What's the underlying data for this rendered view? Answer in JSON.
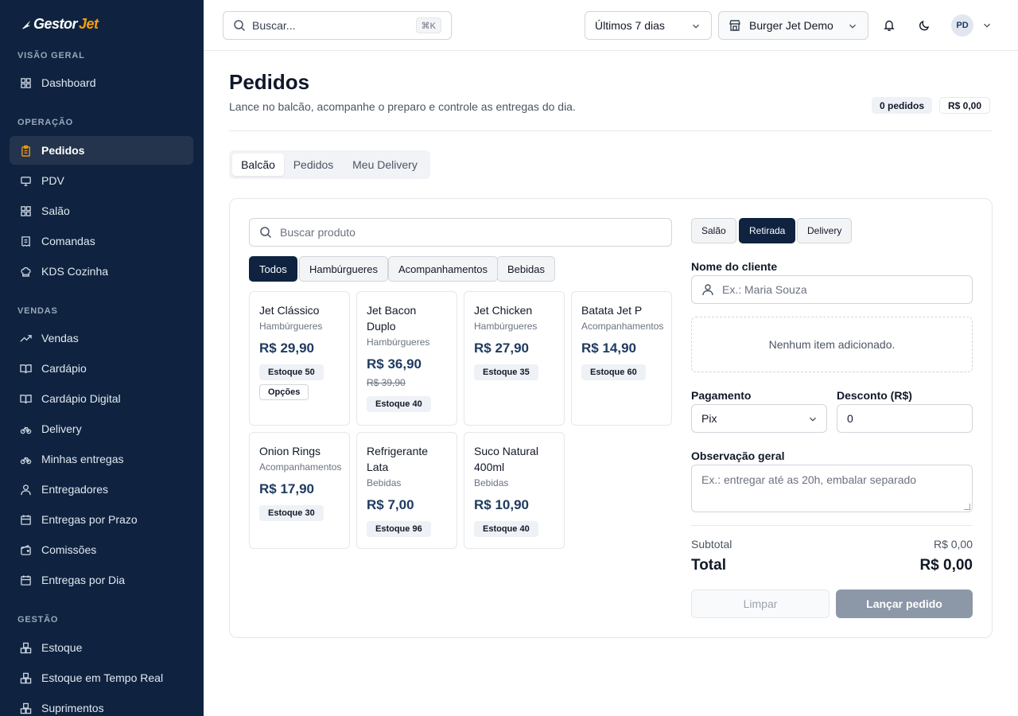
{
  "brand": {
    "logo_main": "Gestor",
    "logo_accent": "Jet"
  },
  "sidebar": {
    "sections": [
      {
        "label": "VISÃO GERAL",
        "items": [
          {
            "label": "Dashboard",
            "icon": "grid-icon"
          }
        ]
      },
      {
        "label": "OPERAÇÃO",
        "items": [
          {
            "label": "Pedidos",
            "icon": "clipboard-icon",
            "active": true
          },
          {
            "label": "PDV",
            "icon": "monitor-icon"
          },
          {
            "label": "Salão",
            "icon": "grid-icon"
          },
          {
            "label": "Comandas",
            "icon": "receipt-icon"
          },
          {
            "label": "KDS Cozinha",
            "icon": "chef-hat-icon"
          }
        ]
      },
      {
        "label": "VENDAS",
        "items": [
          {
            "label": "Vendas",
            "icon": "trending-up-icon"
          },
          {
            "label": "Cardápio",
            "icon": "book-open-icon"
          },
          {
            "label": "Cardápio Digital",
            "icon": "book-open-icon"
          },
          {
            "label": "Delivery",
            "icon": "bike-icon"
          },
          {
            "label": "Minhas entregas",
            "icon": "bike-icon"
          },
          {
            "label": "Entregadores",
            "icon": "user-icon"
          },
          {
            "label": "Entregas por Prazo",
            "icon": "calendar-icon"
          },
          {
            "label": "Comissões",
            "icon": "wallet-icon"
          },
          {
            "label": "Entregas por Dia",
            "icon": "calendar-icon"
          }
        ]
      },
      {
        "label": "GESTÃO",
        "items": [
          {
            "label": "Estoque",
            "icon": "boxes-icon"
          },
          {
            "label": "Estoque em Tempo Real",
            "icon": "boxes-icon"
          },
          {
            "label": "Suprimentos",
            "icon": "boxes-icon"
          }
        ]
      }
    ]
  },
  "topbar": {
    "search_placeholder": "Buscar...",
    "search_shortcut": "⌘K",
    "period": "Últimos 7 dias",
    "store": "Burger Jet Demo",
    "avatar_initials": "PD"
  },
  "page": {
    "title": "Pedidos",
    "subtitle": "Lance no balcão, acompanhe o preparo e controle as entregas do dia.",
    "badge_count": "0 pedidos",
    "badge_total": "R$ 0,00"
  },
  "tabs": [
    {
      "label": "Balcão",
      "active": true
    },
    {
      "label": "Pedidos"
    },
    {
      "label": "Meu Delivery"
    }
  ],
  "products_panel": {
    "search_placeholder": "Buscar produto",
    "categories": [
      {
        "label": "Todos",
        "active": true
      },
      {
        "label": "Hambúrgueres"
      },
      {
        "label": "Acompanhamentos"
      },
      {
        "label": "Bebidas"
      }
    ],
    "products": [
      {
        "name": "Jet Clássico",
        "category": "Hambúrgueres",
        "price": "R$ 29,90",
        "old_price": "",
        "stock": "Estoque 50",
        "options": "Opções"
      },
      {
        "name": "Jet Bacon Duplo",
        "category": "Hambúrgueres",
        "price": "R$ 36,90",
        "old_price": "R$ 39,90",
        "stock": "Estoque 40",
        "options": ""
      },
      {
        "name": "Jet Chicken",
        "category": "Hambúrgueres",
        "price": "R$ 27,90",
        "old_price": "",
        "stock": "Estoque 35",
        "options": ""
      },
      {
        "name": "Batata Jet P",
        "category": "Acompanhamentos",
        "price": "R$ 14,90",
        "old_price": "",
        "stock": "Estoque 60",
        "options": ""
      },
      {
        "name": "Onion Rings",
        "category": "Acompanhamentos",
        "price": "R$ 17,90",
        "old_price": "",
        "stock": "Estoque 30",
        "options": ""
      },
      {
        "name": "Refrigerante Lata",
        "category": "Bebidas",
        "price": "R$ 7,00",
        "old_price": "",
        "stock": "Estoque 96",
        "options": ""
      },
      {
        "name": "Suco Natural 400ml",
        "category": "Bebidas",
        "price": "R$ 10,90",
        "old_price": "",
        "stock": "Estoque 40",
        "options": ""
      }
    ]
  },
  "order_panel": {
    "modes": [
      {
        "label": "Salão"
      },
      {
        "label": "Retirada",
        "active": true
      },
      {
        "label": "Delivery"
      }
    ],
    "customer_label": "Nome do cliente",
    "customer_placeholder": "Ex.: Maria Souza",
    "empty_items": "Nenhum item adicionado.",
    "payment_label": "Pagamento",
    "payment_value": "Pix",
    "discount_label": "Desconto (R$)",
    "discount_value": "0",
    "note_label": "Observação geral",
    "note_placeholder": "Ex.: entregar até as 20h, embalar separado",
    "subtotal_label": "Subtotal",
    "subtotal_value": "R$ 0,00",
    "total_label": "Total",
    "total_value": "R$ 0,00",
    "clear_button": "Limpar",
    "launch_button": "Lançar pedido"
  },
  "colors": {
    "sidebar_bg": "#0f2340",
    "accent": "#f59e0b",
    "primary": "#0f2340"
  }
}
